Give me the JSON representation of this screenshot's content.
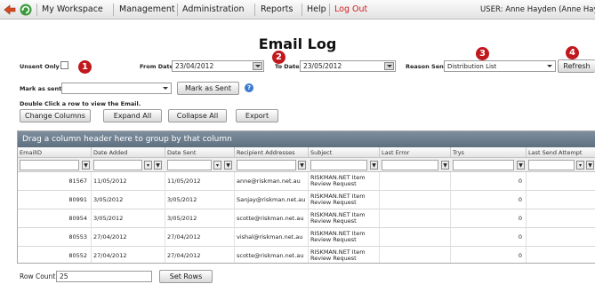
{
  "nav": {
    "items": [
      "My Workspace",
      "Management",
      "Administration",
      "Reports",
      "Help",
      "Log Out"
    ],
    "user": "USER: Anne Hayden (Anne Hayde"
  },
  "title": "Email Log",
  "filters": {
    "unsent_only_label": "Unsent Only",
    "from_date_label": "From Date",
    "from_date": "23/04/2012",
    "to_date_label": "To Date",
    "to_date": "23/05/2012",
    "reason_label": "Reason Sent",
    "reason_value": "Distribution List",
    "refresh_label": "Refresh",
    "mark_as_sent_label": "Mark as sent",
    "mark_as_sent_button": "Mark as Sent",
    "help_glyph": "?"
  },
  "callouts": [
    "1",
    "2",
    "3",
    "4"
  ],
  "hint": "Double Click a row to view the Email.",
  "actions": [
    "Change Columns",
    "Expand All",
    "Collapse All",
    "Export"
  ],
  "grid": {
    "group_hint": "Drag a column header here to group by that column",
    "columns": [
      "EmailID",
      "Date Added",
      "Date Sent",
      "Recipient Addresses",
      "Subject",
      "Last Error",
      "Trys",
      "Last Send Attempt"
    ],
    "rows": [
      [
        "81567",
        "11/05/2012",
        "11/05/2012",
        "anne@riskman.net.au",
        "RISKMAN.NET Item Review Request",
        "",
        "0",
        ""
      ],
      [
        "80991",
        "3/05/2012",
        "3/05/2012",
        "Sanjay@riskman.net.au",
        "RISKMAN.NET Item Review Request",
        "",
        "0",
        ""
      ],
      [
        "80954",
        "3/05/2012",
        "3/05/2012",
        "scotte@riskman.net.au",
        "RISKMAN.NET Item Review Request",
        "",
        "0",
        ""
      ],
      [
        "80553",
        "27/04/2012",
        "27/04/2012",
        "vishal@riskman.net.au",
        "RISKMAN.NET Item Review Request",
        "",
        "0",
        ""
      ],
      [
        "80552",
        "27/04/2012",
        "27/04/2012",
        "scotte@riskman.net.au",
        "RISKMAN.NET Item Review Request",
        "",
        "0",
        ""
      ]
    ]
  },
  "footer": {
    "row_count_label": "Row Count",
    "row_count_value": "25",
    "set_rows_label": "Set Rows"
  },
  "colors": {
    "logout": "#d31c1c",
    "callout": "#c0181d",
    "group_bar": "#6a7b8c"
  },
  "icons": [
    "back-arrow-icon",
    "refresh-icon",
    "calendar-icon",
    "dropdown-arrow-icon",
    "help-icon",
    "filter-icon"
  ]
}
